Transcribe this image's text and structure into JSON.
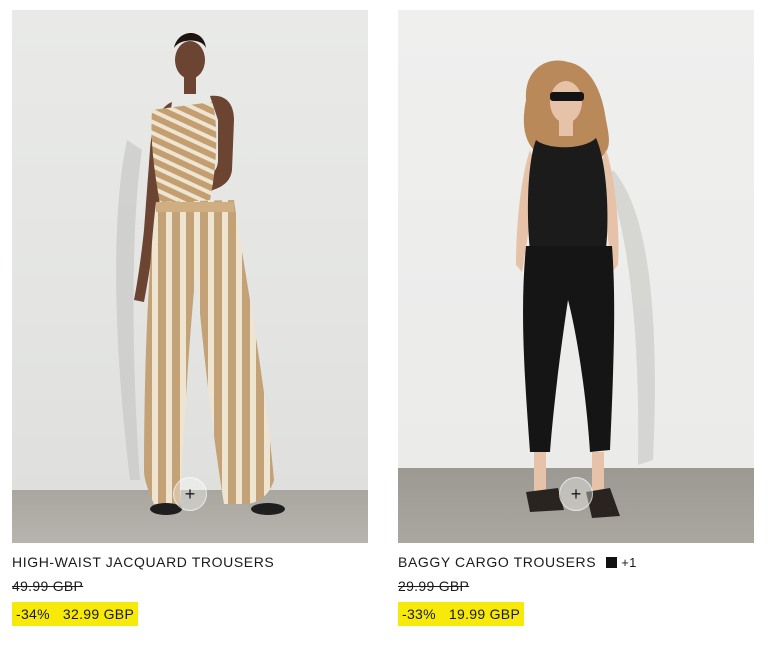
{
  "products": [
    {
      "title": "HIGH-WAIST JACQUARD TROUSERS",
      "old_price": "49.99 GBP",
      "discount": "-34%",
      "price": "32.99 GBP",
      "quick_add_icon": "plus-icon",
      "quick_add_symbol": "+"
    },
    {
      "title": "BAGGY CARGO TROUSERS",
      "color_swatch": "#111111",
      "more_colors": "+1",
      "old_price": "29.99 GBP",
      "discount": "-33%",
      "price": "19.99 GBP",
      "quick_add_icon": "plus-icon",
      "quick_add_symbol": "+"
    }
  ],
  "colors": {
    "sale_highlight": "#f7e90a",
    "text": "#1a1a1a"
  }
}
